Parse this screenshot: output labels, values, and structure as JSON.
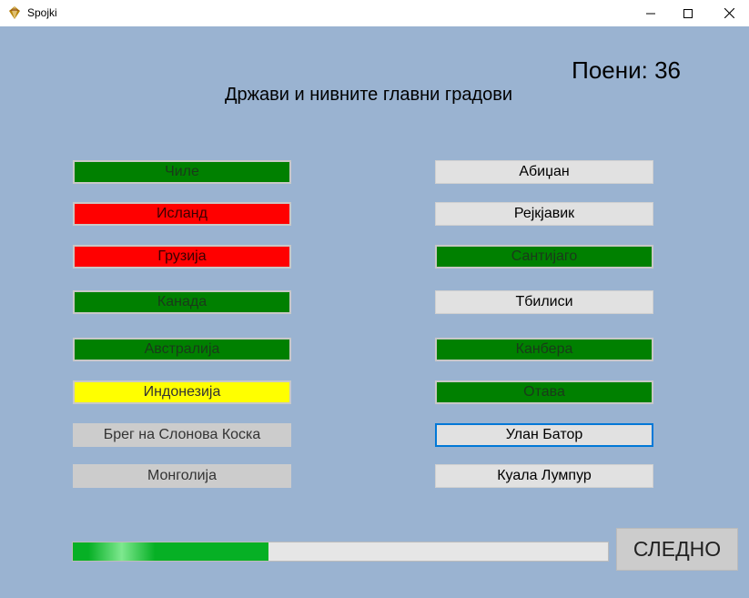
{
  "window": {
    "title": "Spojki",
    "app_icon": "gem-icon",
    "minimize_icon": "minimize-icon",
    "maximize_icon": "maximize-icon",
    "close_icon": "close-icon"
  },
  "header": {
    "points": "Поени: 36",
    "heading": "Држави и нивните главни градови"
  },
  "countries": [
    {
      "label": "Чиле",
      "state": "green"
    },
    {
      "label": "Исланд",
      "state": "red"
    },
    {
      "label": "Грузија",
      "state": "red"
    },
    {
      "label": "Канада",
      "state": "green"
    },
    {
      "label": "Австралија",
      "state": "green"
    },
    {
      "label": "Индонезија",
      "state": "yellow"
    },
    {
      "label": "Брег на Слонова Коска",
      "state": "grey"
    },
    {
      "label": "Монголија",
      "state": "grey"
    }
  ],
  "capitals": [
    {
      "label": "Абиџан",
      "state": "light"
    },
    {
      "label": "Рејкјавик",
      "state": "light"
    },
    {
      "label": "Сантијаго",
      "state": "green"
    },
    {
      "label": "Тбилиси",
      "state": "light"
    },
    {
      "label": "Канбера",
      "state": "green"
    },
    {
      "label": "Отава",
      "state": "green"
    },
    {
      "label": "Улан Батор",
      "state": "focus"
    },
    {
      "label": "Куала Лумпур",
      "state": "light"
    }
  ],
  "progress": {
    "fraction": 0.365
  },
  "next_label": "СЛЕДНО",
  "colors": {
    "background": "#9ab3d1",
    "correct": "#008000",
    "wrong": "#ff0000",
    "selected": "#ffff00",
    "progress": "#06b025",
    "focus": "#0078d7"
  }
}
